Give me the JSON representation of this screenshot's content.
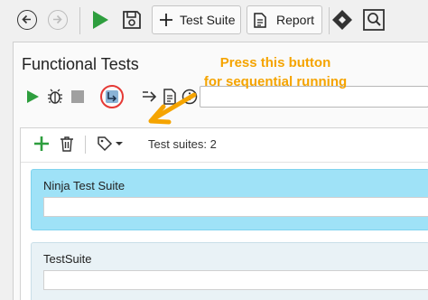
{
  "toolbar": {
    "test_suite_label": "Test Suite",
    "report_label": "Report"
  },
  "panel": {
    "title": "Functional Tests",
    "search_placeholder": ""
  },
  "annotation": {
    "line1": "Press this button",
    "line2": "for sequential running",
    "color": "#f5a400"
  },
  "suites": {
    "count_text": "Test suites: 2",
    "items": [
      {
        "name": "Ninja Test Suite",
        "state": "selected"
      },
      {
        "name": "TestSuite",
        "state": "normal"
      }
    ]
  },
  "colors": {
    "run_green": "#2e9e3e",
    "selected_card": "#9fe2f7",
    "highlight_ring": "#e53935"
  }
}
